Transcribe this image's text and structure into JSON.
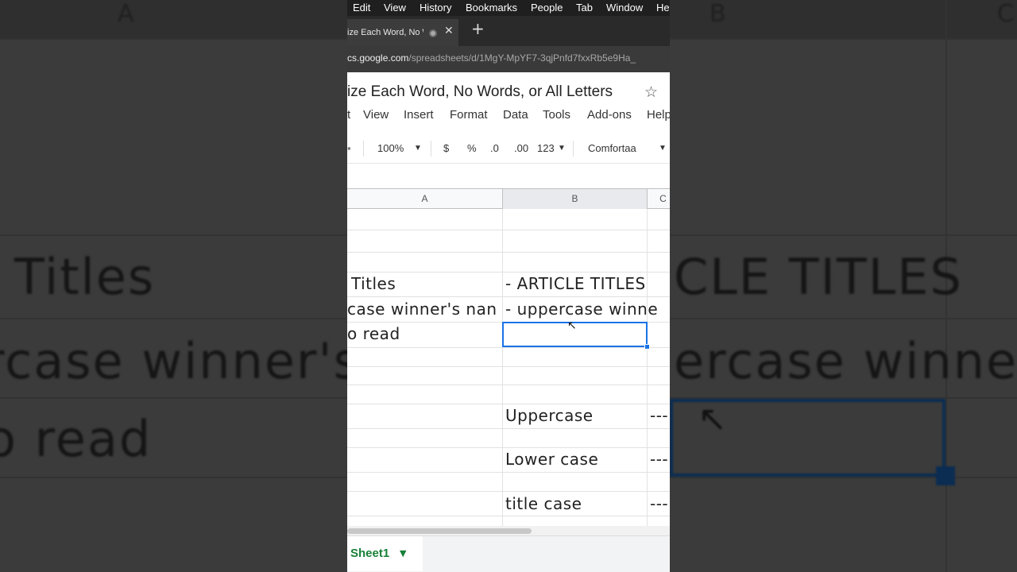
{
  "background": {
    "col_a": "A",
    "col_b": "B",
    "col_c": "C",
    "left_texts": [
      "Titles",
      "rcase winner's",
      "o read"
    ],
    "right_texts": [
      "CLE TITLES",
      "ercase winne"
    ],
    "accent": "#0b2d52"
  },
  "os_menu": [
    "Edit",
    "View",
    "History",
    "Bookmarks",
    "People",
    "Tab",
    "Window",
    "He"
  ],
  "browser": {
    "tab_title": "ize Each Word, No W",
    "url_host": "cs.google.com",
    "url_path": "/spreadsheets/d/1MgY-MpYF7-3qjPnfd7fxxRb5e9Ha_"
  },
  "doc": {
    "title": "ize Each Word, No Words, or All Letters",
    "menu": [
      "t",
      "View",
      "Insert",
      "Format",
      "Data",
      "Tools",
      "Add-ons",
      "Help"
    ]
  },
  "toolbar": {
    "zoom": "100%",
    "currency": "$",
    "percent": "%",
    "dec_decrease": ".0",
    "dec_increase": ".00",
    "number_format": "123",
    "font": "Comfortaa"
  },
  "sheet": {
    "col_headers": [
      "A",
      "B",
      "C"
    ],
    "cells": {
      "a_titles": "Titles",
      "b_titles": "- ARTICLE TITLES",
      "a_winner": "case winner's nan",
      "b_winner": "- uppercase winne",
      "a_read": "o read",
      "b_upper": "Uppercase",
      "c_upper": "---",
      "b_lower": "Lower case",
      "c_lower": "---",
      "b_title": "title case",
      "c_title": "---"
    },
    "tab_name": "Sheet1",
    "selection_color": "#1a73e8"
  }
}
